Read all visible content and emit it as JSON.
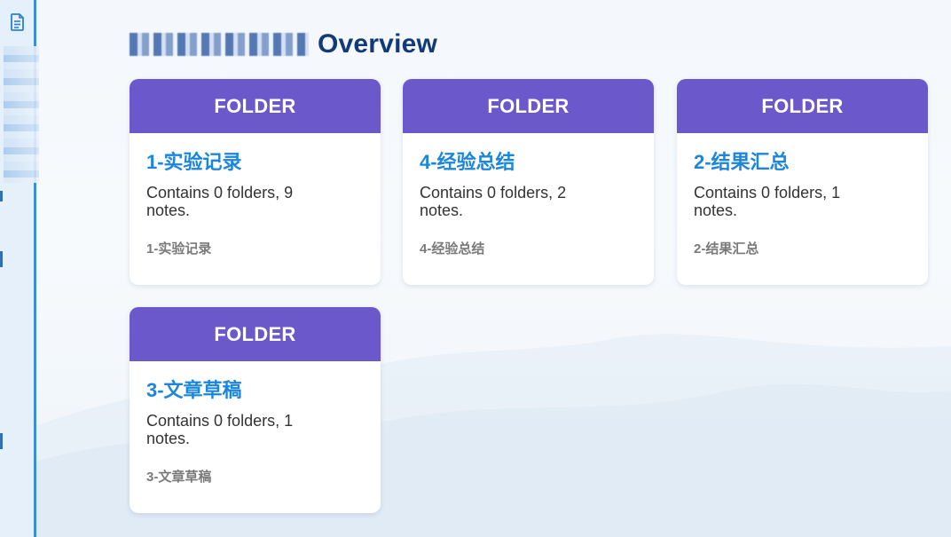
{
  "page": {
    "title": "Overview"
  },
  "cards": [
    {
      "header": "FOLDER",
      "name": "1-实验记录",
      "description": "Contains 0 folders, 9 notes.",
      "path": "1-实验记录"
    },
    {
      "header": "FOLDER",
      "name": "4-经验总结",
      "description": "Contains 0 folders, 2 notes.",
      "path": "4-经验总结"
    },
    {
      "header": "FOLDER",
      "name": "2-结果汇总",
      "description": "Contains 0 folders, 1 notes.",
      "path": "2-结果汇总"
    },
    {
      "header": "FOLDER",
      "name": "3-文章草稿",
      "description": "Contains 0 folders, 1 notes.",
      "path": "3-文章草稿"
    }
  ],
  "sidebar": {
    "top_icon": "document-icon"
  },
  "colors": {
    "card_header": "#6b59cc",
    "card_title": "#1b86dc",
    "page_title": "#123a78",
    "sidebar_accent": "#3a8fd8"
  }
}
